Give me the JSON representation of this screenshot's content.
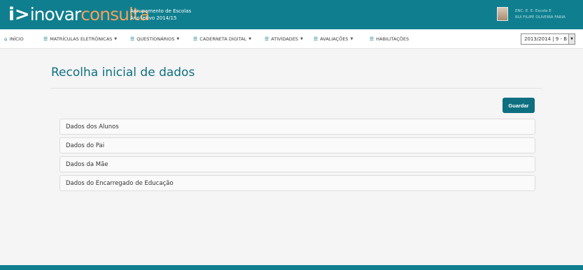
{
  "header": {
    "logo_mark": "i>",
    "logo_inovar": "inovar",
    "logo_consulta": "consulta",
    "school_line1": "Agrupamento de Escolas",
    "school_line2": "Ano letivo 2014/15",
    "user_line1": "ENC. E. E.   Escola E",
    "user_line2": "RUI FILIPE OLIVEIRA FARIA"
  },
  "nav": {
    "inicio": "INÍCIO",
    "matriculas": "MATRÍCULAS ELETRÓNICAS",
    "questionarios": "QUESTIONÁRIOS",
    "caderneta": "CADERNETA DIGITAL",
    "atividades": "ATIVIDADES",
    "avaliacoes": "AVALIAÇÕES",
    "habilitacoes": "HABILITAÇÕES",
    "year_value": "2013/2014 | 9 - B"
  },
  "icons": {
    "home": "home-icon",
    "list": "list-icon",
    "caret": "caret-down-icon"
  },
  "main": {
    "title": "Recolha inicial de dados",
    "save_label": "Guardar",
    "panels": [
      "Dados dos Alunos",
      "Dados do Pai",
      "Dados da Mãe",
      "Dados do Encarregado de Educação"
    ]
  },
  "colors": {
    "brand": "#0f7f8f",
    "accent": "#f2a25c",
    "title": "#0e6f80"
  }
}
